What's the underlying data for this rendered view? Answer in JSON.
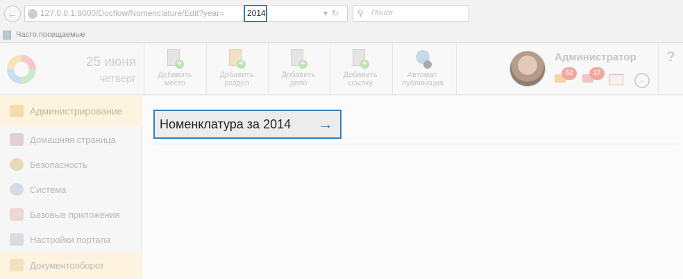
{
  "browser": {
    "url_prefix": "127.0.0.1:8000/Docflow/Nomenclature/Edit?year=",
    "url_year": "2014",
    "search_placeholder": "Поиск",
    "bookmark_label": "Часто посещаемые"
  },
  "header": {
    "day": "25 июня",
    "weekday": "четверг",
    "toolbar": [
      {
        "line1": "Добавить",
        "line2": "место"
      },
      {
        "line1": "Добавить",
        "line2": "раздел"
      },
      {
        "line1": "Добавить",
        "line2": "дело"
      },
      {
        "line1": "Добавить",
        "line2": "ссылку"
      },
      {
        "line1": "Автомат.",
        "line2": "публикация"
      }
    ],
    "user_name": "Администратор",
    "notifications": {
      "messages": "52",
      "tasks": "17"
    },
    "help": "?"
  },
  "sidebar": {
    "items": [
      {
        "label": "Администрирование"
      },
      {
        "label": "Домашняя страница"
      },
      {
        "label": "Безопасность"
      },
      {
        "label": "Система"
      },
      {
        "label": "Базовые приложения"
      },
      {
        "label": "Настройки портала"
      },
      {
        "label": "Документооборот"
      }
    ]
  },
  "main": {
    "title": "Номенклатура за 2014"
  },
  "colors": {
    "accent": "#2f7fbf",
    "active_sidebar": "#fdf3df"
  }
}
